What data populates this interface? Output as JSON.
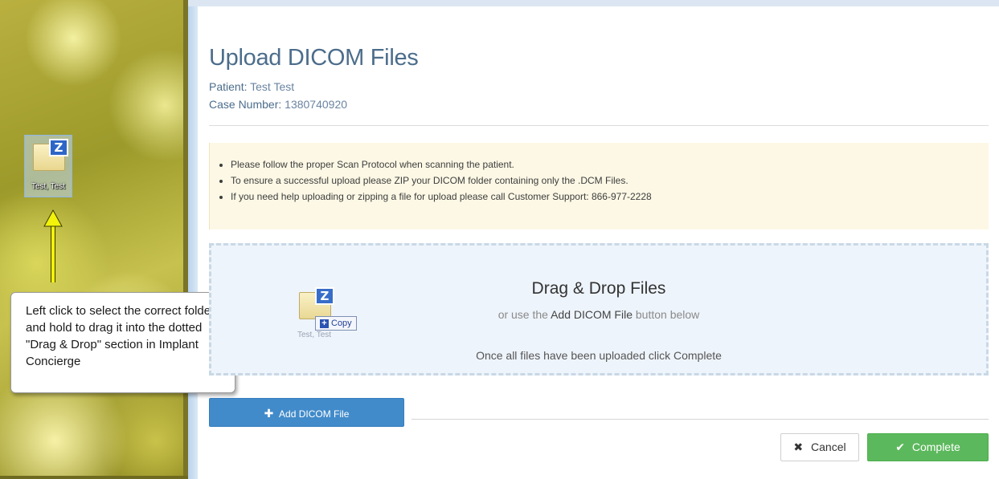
{
  "desktop": {
    "icon_label": "Test, Test",
    "folder_badge": "Z",
    "callout_text": "Left click to select the correct folder and hold to drag it into the dotted \"Drag & Drop\" section in Implant Concierge"
  },
  "page": {
    "title": "Upload DICOM Files",
    "patient_label": "Patient:",
    "patient_value": "Test Test",
    "case_label": "Case Number:",
    "case_value": "1380740920"
  },
  "notice": {
    "items": [
      "Please follow the proper Scan Protocol when scanning the patient.",
      "To ensure a successful upload please ZIP your DICOM folder containing only the .DCM Files.",
      "If you need help uploading or zipping a file for upload please call Customer Support: 866-977-2228"
    ]
  },
  "dropzone": {
    "title": "Drag & Drop Files",
    "sub_prefix": "or use the",
    "sub_bold": "Add DICOM File",
    "sub_suffix": "button below",
    "footer": "Once all files have been uploaded click Complete",
    "ghost_copy_label": "Copy",
    "ghost_label": "Test, Test"
  },
  "actions": {
    "add_label": "Add DICOM File",
    "cancel_label": "Cancel",
    "complete_label": "Complete"
  },
  "colors": {
    "primary": "#428bca",
    "success": "#5cb85c",
    "arrow": "#f2f20a"
  },
  "icons": {
    "add": "plus-icon",
    "cancel": "times-icon",
    "complete": "check-icon",
    "folder": "zip-folder-icon"
  }
}
